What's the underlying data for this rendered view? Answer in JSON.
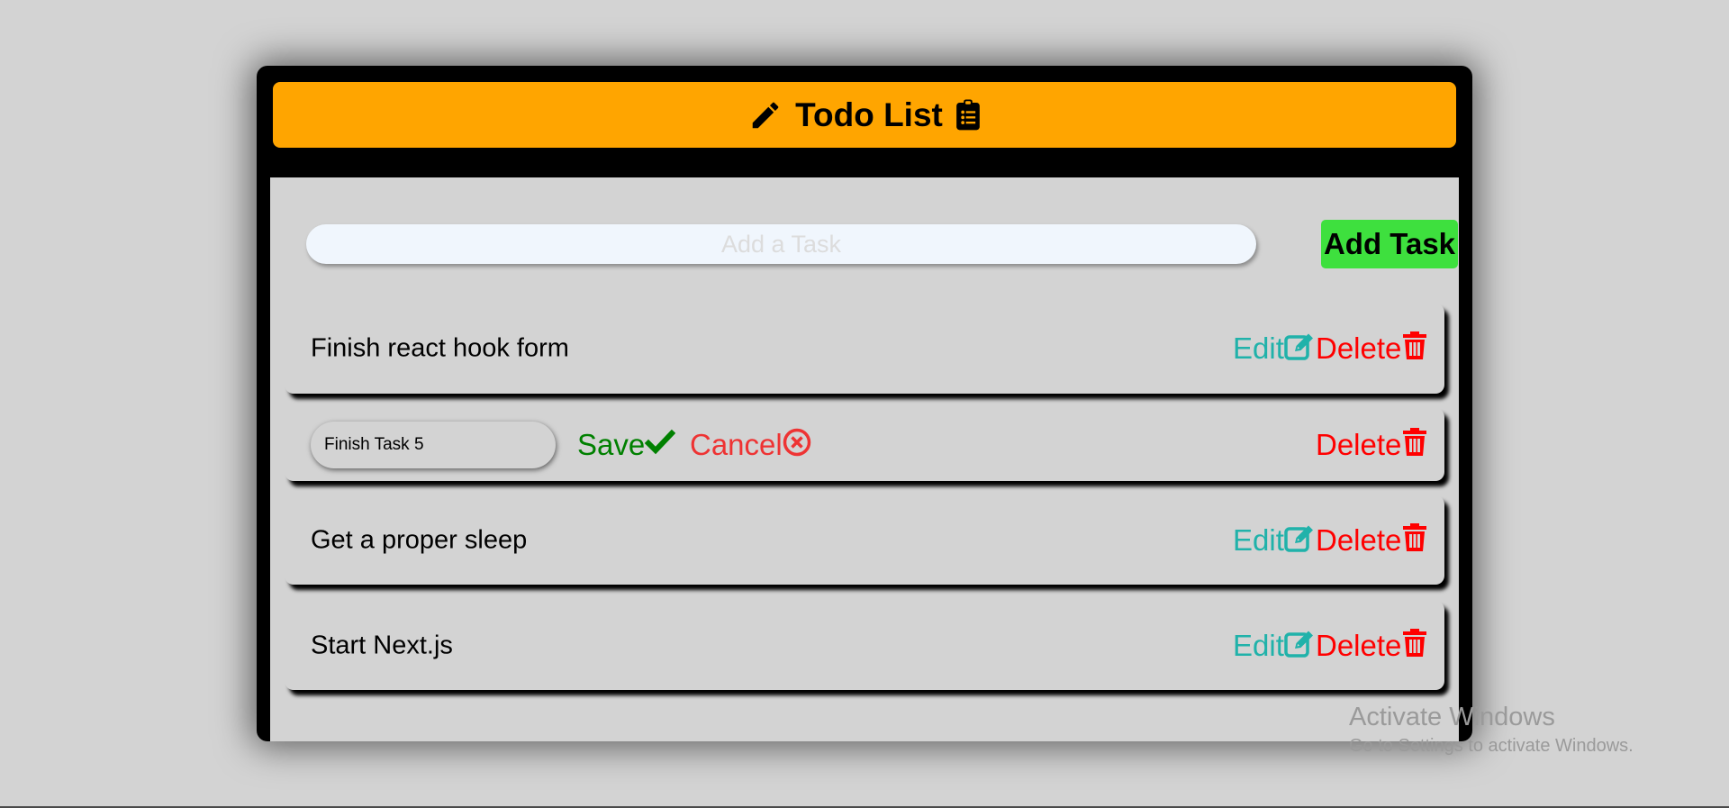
{
  "header": {
    "title": "Todo List",
    "left_icon": "pencil-icon",
    "right_icon": "clipboard-list-icon"
  },
  "add_form": {
    "placeholder": "Add a Task",
    "value": "",
    "button_label": "Add Task"
  },
  "tasks": [
    {
      "text": "Finish react hook form",
      "editing": false,
      "edit_label": "Edit",
      "delete_label": "Delete"
    },
    {
      "text": "Finish Task 5",
      "editing": true,
      "save_label": "Save",
      "cancel_label": "Cancel",
      "delete_label": "Delete"
    },
    {
      "text": "Get a proper sleep",
      "editing": false,
      "edit_label": "Edit",
      "delete_label": "Delete"
    },
    {
      "text": "Start Next.js",
      "editing": false,
      "edit_label": "Edit",
      "delete_label": "Delete"
    }
  ],
  "colors": {
    "header": "#ffa500",
    "add_button": "#3ee03e",
    "edit": "#20b2aa",
    "delete": "#ff0000",
    "save": "#008000",
    "cancel": "#ee3333"
  },
  "watermark": {
    "line1": "Activate Windows",
    "line2": "Go to Settings to activate Windows."
  }
}
